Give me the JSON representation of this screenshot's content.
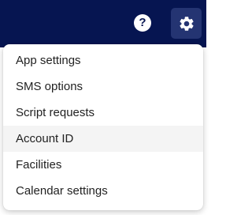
{
  "colors": {
    "topbar_bg": "#061551",
    "settings_button_bg": "#243472",
    "icon_color": "#ffffff",
    "menu_hover_bg": "#f4f4f4",
    "menu_text": "#222222"
  },
  "topbar": {
    "help_icon": "help-circle-icon",
    "help_glyph": "?",
    "settings_icon": "gear-icon"
  },
  "menu": {
    "items": [
      {
        "label": "App settings",
        "active": false
      },
      {
        "label": "SMS options",
        "active": false
      },
      {
        "label": "Script requests",
        "active": false
      },
      {
        "label": "Account ID",
        "active": true
      },
      {
        "label": "Facilities",
        "active": false
      },
      {
        "label": "Calendar settings",
        "active": false
      }
    ]
  }
}
